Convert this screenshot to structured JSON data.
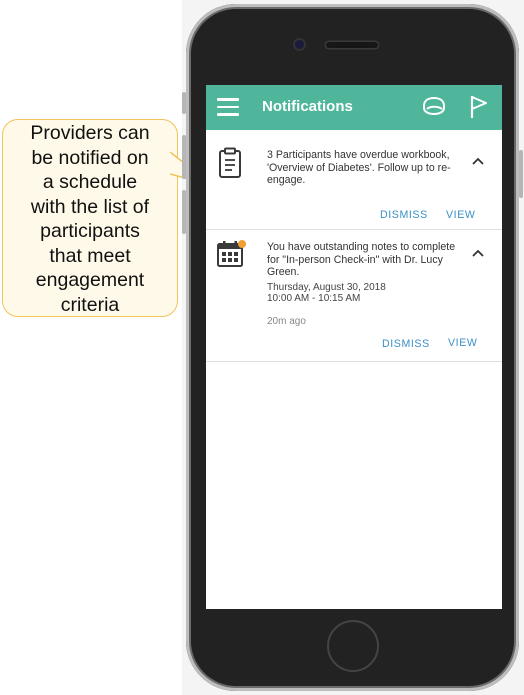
{
  "callout": {
    "text": "Providers can\nbe notified on\na schedule\nwith the list of\nparticipants\nthat meet\nengagement\ncriteria"
  },
  "app": {
    "title": "Notifications"
  },
  "notifications": [
    {
      "icon": "clipboard-icon",
      "message": "3 Participants have overdue workbook, 'Overview of Diabetes'. Follow up to re-engage.",
      "dismiss_label": "DISMISS",
      "view_label": "VIEW"
    },
    {
      "icon": "calendar-alert-icon",
      "message": "You have outstanding notes to complete for \"In-person Check-in\" with Dr. Lucy Green.",
      "date": "Thursday, August 30, 2018",
      "time": "10:00 AM - 10:15 AM",
      "age": "20m ago",
      "dismiss_label": "DISMISS",
      "view_label": "VIEW"
    }
  ],
  "colors": {
    "appbar": "#4fb69b",
    "action": "#3a8fc6",
    "badge": "#f0a030",
    "callout_border": "#f0c45a",
    "callout_fill": "#fff9ea"
  }
}
